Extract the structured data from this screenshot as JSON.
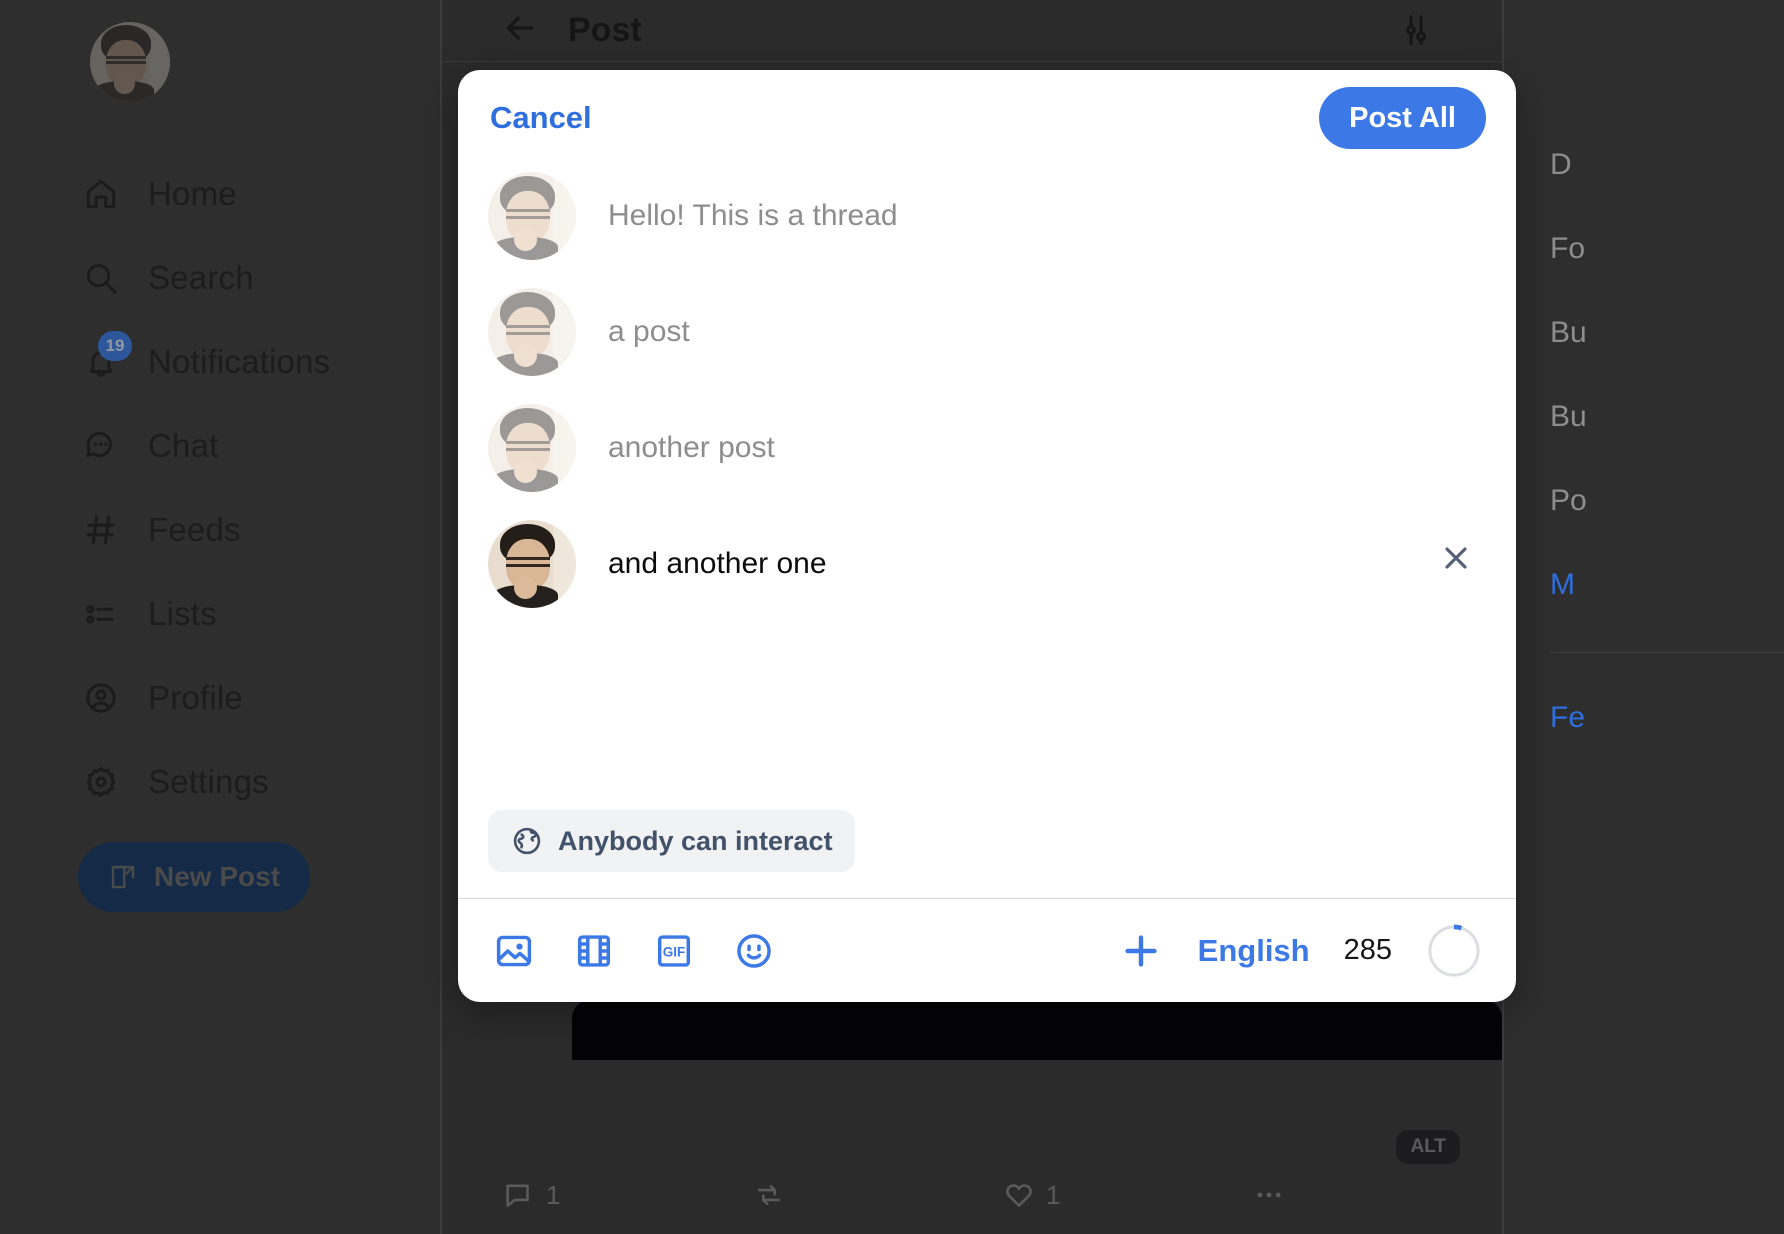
{
  "sidebar": {
    "avatar_alt": "user-avatar",
    "items": [
      {
        "label": "Home",
        "icon": "home-icon",
        "badge": null
      },
      {
        "label": "Search",
        "icon": "search-icon",
        "badge": null
      },
      {
        "label": "Notifications",
        "icon": "bell-icon",
        "badge": "19"
      },
      {
        "label": "Chat",
        "icon": "chat-bubble-icon",
        "badge": null
      },
      {
        "label": "Feeds",
        "icon": "hashtag-icon",
        "badge": null
      },
      {
        "label": "Lists",
        "icon": "list-icon",
        "badge": null
      },
      {
        "label": "Profile",
        "icon": "person-circle-icon",
        "badge": null
      },
      {
        "label": "Settings",
        "icon": "gear-icon",
        "badge": null
      }
    ],
    "new_post_label": "New Post"
  },
  "main_header": {
    "title": "Post",
    "back_icon": "arrow-left-icon",
    "settings_icon": "sliders-icon"
  },
  "background_post": {
    "alt_badge": "ALT",
    "reply_count": "1",
    "repost_count": "",
    "like_count": "1",
    "more_icon": "ellipsis-icon"
  },
  "right_sidebar": {
    "items": [
      "D",
      "Fo",
      "Bu",
      "Bu",
      "Po",
      "M",
      "Fe"
    ]
  },
  "modal": {
    "cancel_label": "Cancel",
    "post_all_label": "Post All",
    "posts": [
      {
        "text": "Hello! This is a thread",
        "state": "inactive"
      },
      {
        "text": "a post",
        "state": "inactive"
      },
      {
        "text": "another post",
        "state": "inactive"
      },
      {
        "text": "and another one",
        "state": "active"
      }
    ],
    "remove_icon": "close-icon",
    "interaction": {
      "label": "Anybody can interact",
      "icon": "globe-icon"
    },
    "footer": {
      "image_icon": "image-icon",
      "video_icon": "film-strip-icon",
      "gif_icon": "gif-icon",
      "emoji_icon": "emoji-smiley-icon",
      "gif_label": "GIF",
      "add_icon": "plus-icon",
      "language_label": "English",
      "char_count": "285",
      "progress_percent": 5
    },
    "accent_color": "#3c79e6",
    "link_color": "#2f6fdd"
  }
}
